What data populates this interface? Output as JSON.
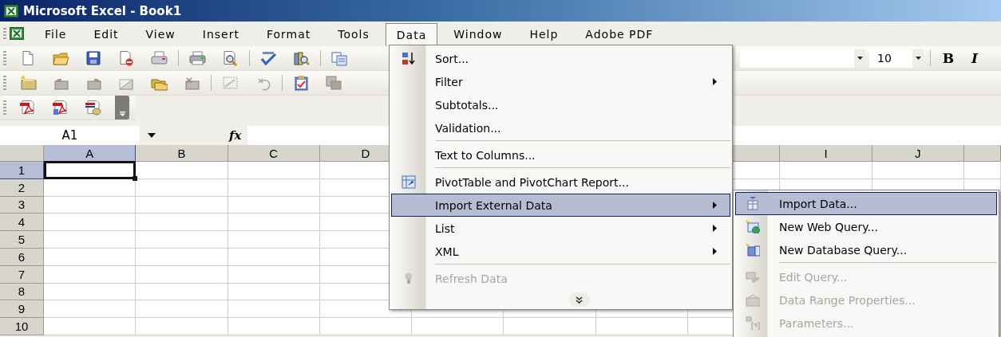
{
  "window": {
    "title": "Microsoft Excel - Book1"
  },
  "menu_bar": [
    {
      "label": "File",
      "selected": false
    },
    {
      "label": "Edit",
      "selected": false
    },
    {
      "label": "View",
      "selected": false
    },
    {
      "label": "Insert",
      "selected": false
    },
    {
      "label": "Format",
      "selected": false
    },
    {
      "label": "Tools",
      "selected": false
    },
    {
      "label": "Data",
      "selected": true
    },
    {
      "label": "Window",
      "selected": false
    },
    {
      "label": "Help",
      "selected": false
    },
    {
      "label": "Adobe PDF",
      "selected": false
    }
  ],
  "formatting_toolbar": {
    "font_size": "10",
    "bold": "B",
    "italic": "I"
  },
  "formula_bar": {
    "name_box": "A1",
    "function_label": "fx"
  },
  "sheet": {
    "columns": [
      {
        "label": "A",
        "selected": true
      },
      {
        "label": "B",
        "selected": false
      },
      {
        "label": "C",
        "selected": false
      },
      {
        "label": "D",
        "selected": false
      },
      {
        "label": "I",
        "selected": false
      },
      {
        "label": "J",
        "selected": false
      }
    ],
    "rows": [
      {
        "label": "1",
        "selected": true
      },
      {
        "label": "2",
        "selected": false
      },
      {
        "label": "3",
        "selected": false
      },
      {
        "label": "4",
        "selected": false
      },
      {
        "label": "5",
        "selected": false
      },
      {
        "label": "6",
        "selected": false
      },
      {
        "label": "7",
        "selected": false
      },
      {
        "label": "8",
        "selected": false
      },
      {
        "label": "9",
        "selected": false
      },
      {
        "label": "10",
        "selected": false
      }
    ]
  },
  "data_menu": {
    "items": [
      {
        "kind": "command",
        "label": "Sort...",
        "submenu": false,
        "disabled": false,
        "selected": false
      },
      {
        "kind": "command",
        "label": "Filter",
        "submenu": true,
        "disabled": false,
        "selected": false
      },
      {
        "kind": "command",
        "label": "Subtotals...",
        "submenu": false,
        "disabled": false,
        "selected": false
      },
      {
        "kind": "command",
        "label": "Validation...",
        "submenu": false,
        "disabled": false,
        "selected": false
      },
      {
        "kind": "separator"
      },
      {
        "kind": "command",
        "label": "Text to Columns...",
        "submenu": false,
        "disabled": false,
        "selected": false
      },
      {
        "kind": "separator"
      },
      {
        "kind": "command",
        "label": "PivotTable and PivotChart Report...",
        "submenu": false,
        "disabled": false,
        "selected": false
      },
      {
        "kind": "command",
        "label": "Import External Data",
        "submenu": true,
        "disabled": false,
        "selected": true
      },
      {
        "kind": "command",
        "label": "List",
        "submenu": true,
        "disabled": false,
        "selected": false
      },
      {
        "kind": "command",
        "label": "XML",
        "submenu": true,
        "disabled": false,
        "selected": false
      },
      {
        "kind": "separator"
      },
      {
        "kind": "command",
        "label": "Refresh Data",
        "submenu": false,
        "disabled": true,
        "selected": false
      },
      {
        "kind": "expand"
      }
    ]
  },
  "import_submenu": {
    "items": [
      {
        "kind": "command",
        "label": "Import Data...",
        "submenu": false,
        "disabled": false,
        "selected": true
      },
      {
        "kind": "command",
        "label": "New Web Query...",
        "submenu": false,
        "disabled": false,
        "selected": false
      },
      {
        "kind": "command",
        "label": "New Database Query...",
        "submenu": false,
        "disabled": false,
        "selected": false
      },
      {
        "kind": "separator"
      },
      {
        "kind": "command",
        "label": "Edit Query...",
        "submenu": false,
        "disabled": true,
        "selected": false
      },
      {
        "kind": "command",
        "label": "Data Range Properties...",
        "submenu": false,
        "disabled": true,
        "selected": false
      },
      {
        "kind": "command",
        "label": "Parameters...",
        "submenu": false,
        "disabled": true,
        "selected": false
      }
    ]
  }
}
